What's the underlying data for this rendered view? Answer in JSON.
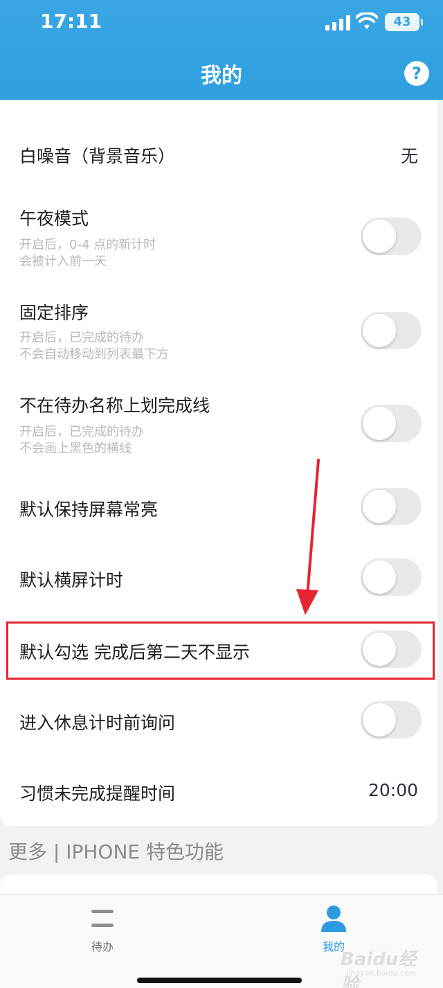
{
  "status_bar": {
    "time": "17:11",
    "battery": "43"
  },
  "header": {
    "title": "我的",
    "help_label": "?"
  },
  "settings": {
    "white_noise": {
      "title": "白噪音（背景音乐）",
      "value": "无"
    },
    "midnight_mode": {
      "title": "午夜模式",
      "desc_line1": "开启后，0-4 点的新计时",
      "desc_line2": "会被计入前一天",
      "enabled": false
    },
    "fixed_sort": {
      "title": "固定排序",
      "desc_line1": "开启后，已完成的待办",
      "desc_line2": "不会自动移动到列表最下方",
      "enabled": false
    },
    "no_strikethrough": {
      "title": "不在待办名称上划完成线",
      "desc_line1": "开启后，已完成的待办",
      "desc_line2": "不会画上黑色的横线",
      "enabled": false
    },
    "keep_screen_on": {
      "title": "默认保持屏幕常亮",
      "enabled": false
    },
    "landscape_timer": {
      "title": "默认横屏计时",
      "enabled": false
    },
    "hide_next_day": {
      "title": "默认勾选 完成后第二天不显示",
      "enabled": false
    },
    "ask_before_rest": {
      "title": "进入休息计时前询问",
      "enabled": false
    },
    "habit_reminder": {
      "title": "习惯未完成提醒时间",
      "value": "20:00"
    }
  },
  "more_section": {
    "title": "更多 | IPHONE 特色功能"
  },
  "tabbar": {
    "tabs": [
      {
        "label": "待办",
        "icon": "menu-icon"
      },
      {
        "label": "我的",
        "icon": "person-icon"
      }
    ]
  },
  "watermark": {
    "brand": "Baidu经验",
    "site": "jingyan.baidu.com"
  },
  "colors": {
    "header": "#2f9fe0",
    "accent": "#2b9ae0",
    "highlight_border": "#e52530",
    "toggle_off": "#e9e9eb"
  }
}
